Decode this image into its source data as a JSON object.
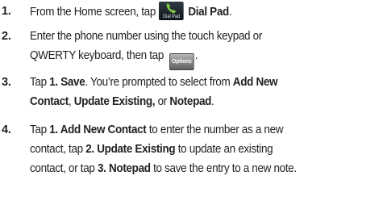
{
  "steps": [
    {
      "number": "1.",
      "lines": [
        {
          "a": "From the Home screen, tap ",
          "icon_label": "Dial Pad",
          "b_bold": "Dial Pad",
          "c": "."
        }
      ]
    },
    {
      "number": "2.",
      "lines": [
        {
          "a": "Enter the phone number using the touch keypad or"
        },
        {
          "a": "QWERTY keyboard, then tap ",
          "button_label": "Options",
          "c": "."
        }
      ]
    },
    {
      "number": "3.",
      "lines": [
        {
          "a": "Tap ",
          "b1": "1. Save",
          "c": ". You’re prompted to select from ",
          "b2": "Add New"
        },
        {
          "b1": "Contact",
          "c": ", ",
          "b2": "Update Existing,",
          "d": " or ",
          "b3": "Notepad",
          "e": "."
        }
      ]
    },
    {
      "number": "4.",
      "lines": [
        {
          "a": "Tap ",
          "b1": "1. Add New Contact",
          "c": " to enter the number as a new"
        },
        {
          "a": "contact, tap ",
          "b1": "2. Update Existing",
          "c": " to update an existing"
        },
        {
          "a": "contact, or tap ",
          "b1": "3. Notepad",
          "c": " to save the entry to a new note."
        }
      ]
    }
  ],
  "icons": {
    "dial_pad": "phone-handset-icon",
    "accent": "#7cc243"
  }
}
